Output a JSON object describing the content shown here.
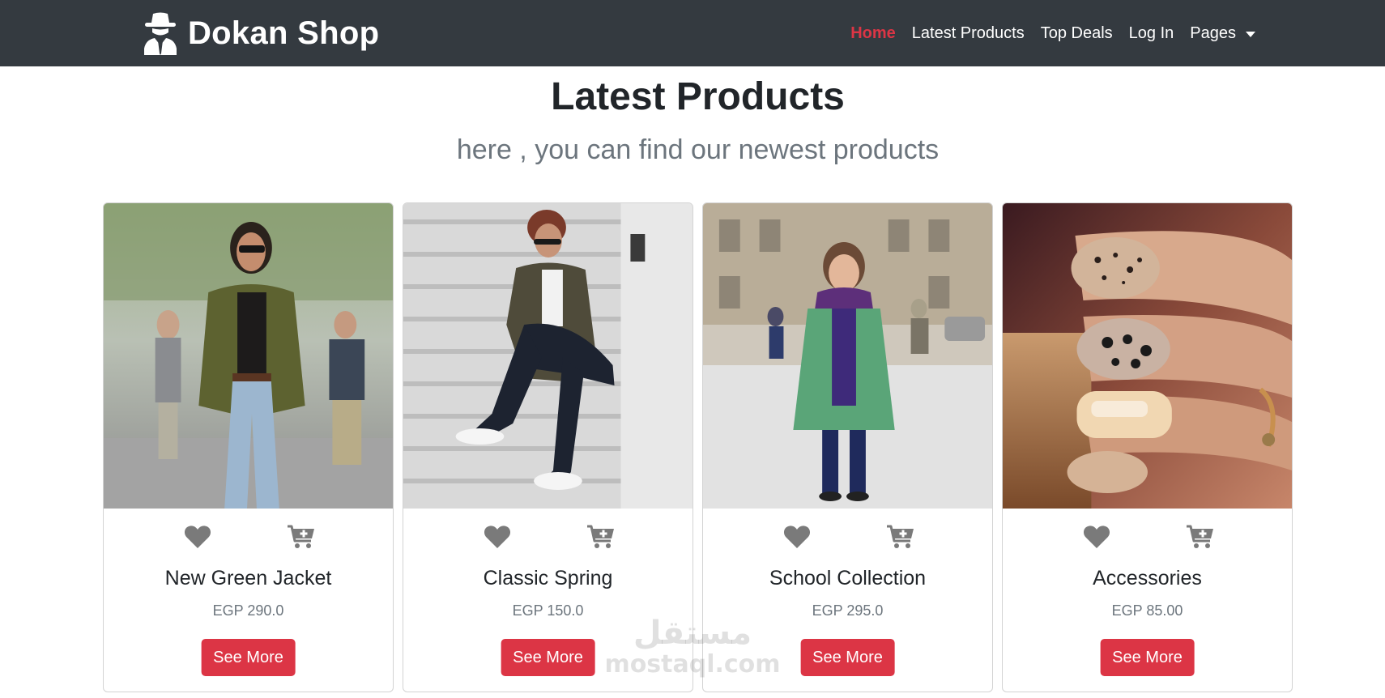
{
  "nav": {
    "brand": "Dokan Shop",
    "links": [
      {
        "label": "Home",
        "active": true
      },
      {
        "label": "Latest Products",
        "active": false
      },
      {
        "label": "Top Deals",
        "active": false
      },
      {
        "label": "Log In",
        "active": false
      }
    ],
    "dropdown_label": "Pages"
  },
  "section": {
    "title": "Latest Products",
    "subtitle": "here , you can find our newest products"
  },
  "products": [
    {
      "name": "New Green Jacket",
      "price": "EGP 290.0",
      "button": "See More"
    },
    {
      "name": "Classic Spring",
      "price": "EGP 150.0",
      "button": "See More"
    },
    {
      "name": "School Collection",
      "price": "EGP 295.0",
      "button": "See More"
    },
    {
      "name": "Accessories",
      "price": "EGP 85.00",
      "button": "See More"
    }
  ],
  "watermark": {
    "arabic": "مستقل",
    "latin": "mostaql.com"
  },
  "icons": {
    "brand": "spy-icon",
    "favorite": "heart-icon",
    "cart": "cart-plus-icon",
    "dropdown": "caret-down-icon"
  },
  "colors": {
    "navbar": "#343a40",
    "accent": "#dc3545",
    "muted": "#6c757d",
    "icon": "#7a7a7a"
  }
}
